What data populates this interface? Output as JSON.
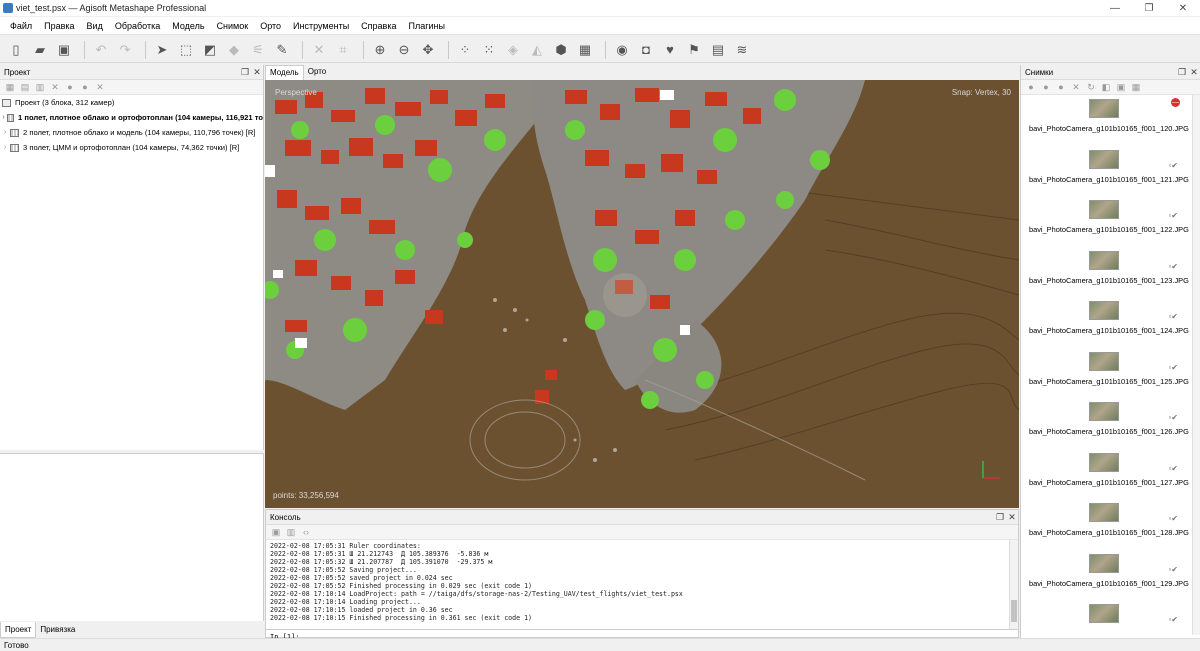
{
  "window": {
    "title": "viet_test.psx — Agisoft Metashape Professional",
    "controls": [
      "—",
      "❐",
      "✕"
    ]
  },
  "menu": [
    "Файл",
    "Правка",
    "Вид",
    "Обработка",
    "Модель",
    "Снимок",
    "Орто",
    "Инструменты",
    "Справка",
    "Плагины"
  ],
  "toolbar_icons": [
    "new-file",
    "open-folder",
    "save",
    "undo",
    "redo",
    "navigation",
    "rect-select",
    "circle-select",
    "free-form",
    "ruler",
    "draw-polygon",
    "delete",
    "crop",
    "zoom-in",
    "zoom-out",
    "move",
    "dense-cloud",
    "tie-points",
    "model",
    "texture",
    "tiled",
    "ortho",
    "globe",
    "camera",
    "shape",
    "marker",
    "region",
    "layers"
  ],
  "project": {
    "header": "Проект",
    "root": "Проект (3 блока, 312 камер)",
    "chunks": [
      {
        "label": "1 полет, плотное облако и ортофотоплан (104 камеры, 116,921 то",
        "active": true
      },
      {
        "label": "2 полет, плотное облако и модель (104 камеры, 110,796 точек) [R]",
        "active": false
      },
      {
        "label": "3 полет, ЦММ и ортофотоплан (104 камеры, 74,362 точки) [R]",
        "active": false
      }
    ]
  },
  "bottom_tabs": [
    "Проект",
    "Привязка"
  ],
  "status": "Готово",
  "view_tabs": [
    "Модель",
    "Орто"
  ],
  "viewport": {
    "mode_label": "Perspective",
    "snap_label": "Snap: Vertex, 30",
    "points_label": "points: 33,256,594"
  },
  "console": {
    "header": "Консоль",
    "lines": [
      "2022-02-08 17:05:31 Ruler coordinates:",
      "2022-02-08 17:05:31 Ш 21.212743  Д 105.389376  -5.836 м",
      "2022-02-08 17:05:32 Ш 21.207787  Д 105.391070  -29.375 м",
      "2022-02-08 17:05:52 Saving project...",
      "2022-02-08 17:05:52 saved project in 0.024 sec",
      "2022-02-08 17:05:52 Finished processing in 0.029 sec (exit code 1)",
      "2022-02-08 17:10:14 LoadProject: path = //taiga/dfs/storage-nas-2/Testing_UAV/test_flights/viet_test.psx",
      "2022-02-08 17:10:14 Loading project...",
      "2022-02-08 17:10:15 loaded project in 0.36 sec",
      "2022-02-08 17:10:15 Finished processing in 0.361 sec (exit code 1)"
    ],
    "prompt": "In [1]:"
  },
  "photos": {
    "header": "Снимки",
    "items": [
      {
        "name": "bavi_PhotoCamera_g101b10165_f001_120.JPG",
        "status": "warn"
      },
      {
        "name": "bavi_PhotoCamera_g101b10165_f001_121.JPG",
        "status": "ok"
      },
      {
        "name": "bavi_PhotoCamera_g101b10165_f001_122.JPG",
        "status": "ok"
      },
      {
        "name": "bavi_PhotoCamera_g101b10165_f001_123.JPG",
        "status": "ok"
      },
      {
        "name": "bavi_PhotoCamera_g101b10165_f001_124.JPG",
        "status": "ok"
      },
      {
        "name": "bavi_PhotoCamera_g101b10165_f001_125.JPG",
        "status": "ok"
      },
      {
        "name": "bavi_PhotoCamera_g101b10165_f001_126.JPG",
        "status": "ok"
      },
      {
        "name": "bavi_PhotoCamera_g101b10165_f001_127.JPG",
        "status": "ok"
      },
      {
        "name": "bavi_PhotoCamera_g101b10165_f001_128.JPG",
        "status": "ok"
      },
      {
        "name": "bavi_PhotoCamera_g101b10165_f001_129.JPG",
        "status": "ok"
      },
      {
        "name": "",
        "status": "ok"
      }
    ]
  },
  "colors": {
    "terrain": "#6b5130",
    "roofs": "#c8381f",
    "vegetation": "#6ccf3e",
    "accent": "#3b7bbf"
  }
}
